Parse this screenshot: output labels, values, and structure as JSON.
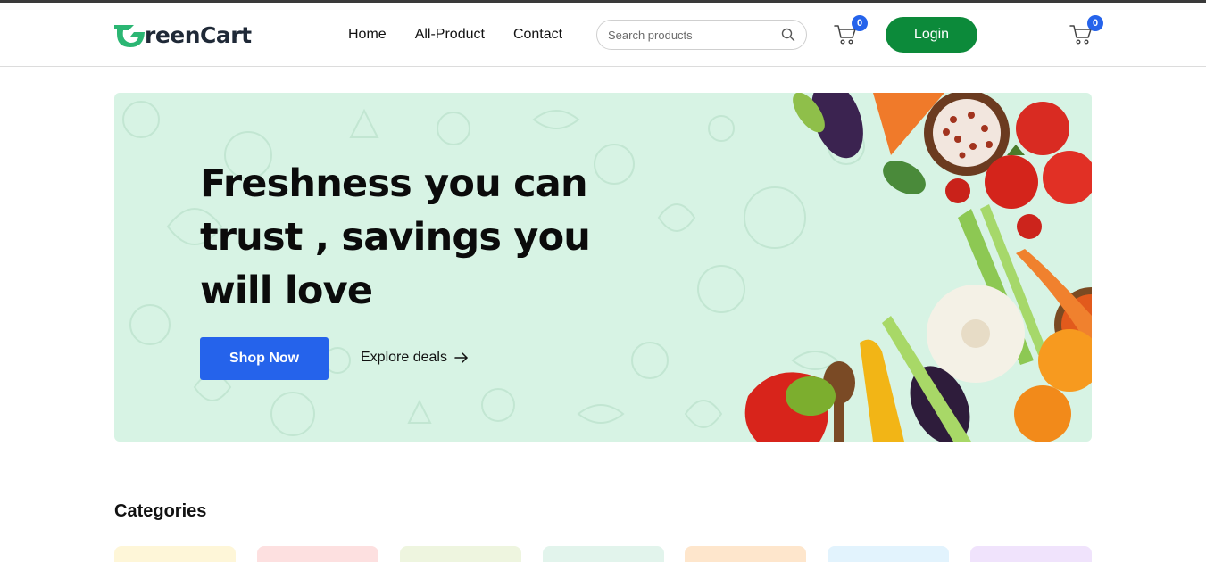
{
  "brand": {
    "name": "GreenCart",
    "text_rest": "reenCart",
    "accent": "#16a34a"
  },
  "nav": {
    "links": [
      {
        "label": "Home"
      },
      {
        "label": "All-Product"
      },
      {
        "label": "Contact"
      }
    ]
  },
  "search": {
    "placeholder": "Search products",
    "icon": "search-icon"
  },
  "cart": {
    "count": "0",
    "badge_color": "#2563eb",
    "icon": "cart-icon"
  },
  "login": {
    "label": "Login",
    "color": "#0c8a3a"
  },
  "hero": {
    "title": "Freshness you can trust , savings you will love",
    "cta_primary": "Shop Now",
    "cta_secondary": "Explore deals",
    "background": "#d7f3e4"
  },
  "categories": {
    "title": "Categories",
    "card_colors": [
      "#fef6d8",
      "#fde0e0",
      "#eef5df",
      "#e2f4ec",
      "#fee6cc",
      "#e2f3fd",
      "#f0e3fc"
    ]
  }
}
